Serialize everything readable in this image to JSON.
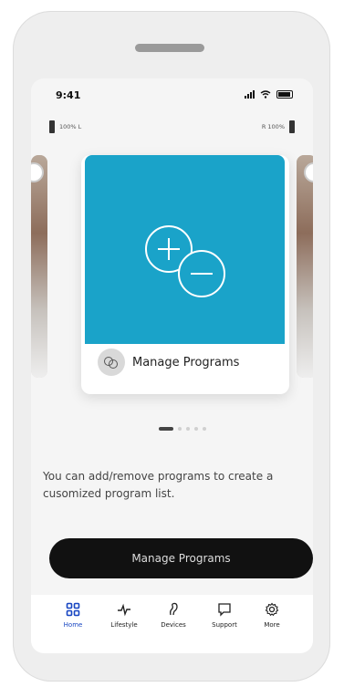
{
  "status_bar": {
    "time": "9:41"
  },
  "hearing": {
    "left_label": "100% L",
    "right_label": "R 100%"
  },
  "card": {
    "title": "Manage Programs",
    "art_color": "#1aa3c9"
  },
  "pager": {
    "total": 5,
    "active_index": 0
  },
  "description": "You can add/remove programs to create a cusomized program list.",
  "cta_label": "Manage Programs",
  "tabs": [
    {
      "label": "Home",
      "icon": "home-grid-icon",
      "active": true
    },
    {
      "label": "Lifestyle",
      "icon": "pulse-icon",
      "active": false
    },
    {
      "label": "Devices",
      "icon": "ear-icon",
      "active": false
    },
    {
      "label": "Support",
      "icon": "chat-bubble-icon",
      "active": false
    },
    {
      "label": "More",
      "icon": "gear-icon",
      "active": false
    }
  ],
  "colors": {
    "accent": "#1846c2",
    "cta_bg": "#111111"
  }
}
